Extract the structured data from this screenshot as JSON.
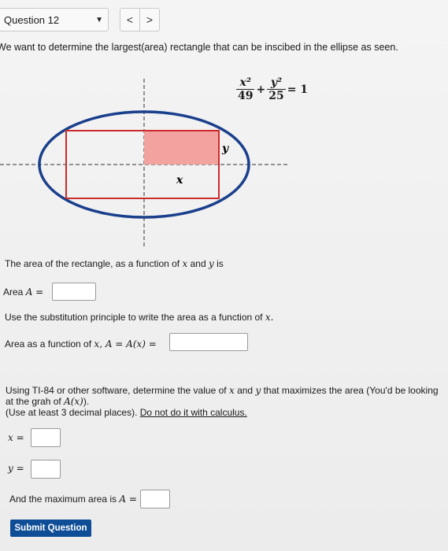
{
  "header": {
    "question_label": "Question 12",
    "prev_symbol": "<",
    "next_symbol": ">"
  },
  "intro": "We want to determine the largest(area) rectangle that can be inscibed in the ellipse as seen.",
  "figure": {
    "equation": {
      "term1_num": "x²",
      "term1_den": "49",
      "plus": "+",
      "term2_num": "y²",
      "term2_den": "25",
      "equals": "= 1"
    },
    "label_x": "x",
    "label_y": "y",
    "colors": {
      "ellipse": "#1a3f8c",
      "rectangle": "#cc2b2b",
      "shaded": "#f2a3a0",
      "axes": "#333333"
    }
  },
  "part1": {
    "prompt_pre": "The area of the rectangle, as a function of",
    "var_x": "x",
    "and": "and",
    "var_y": "y",
    "is": "is",
    "label_text": "Area",
    "label_math": "A ="
  },
  "part2": {
    "prompt_pre": "Use the substitution principle to write the area as a function of",
    "prompt_var": "x.",
    "label_text": "Area as a function of",
    "label_math": "x, A = A(x) ="
  },
  "part3": {
    "line1_pre": "Using TI-84 or other software, determine the value of",
    "line1_x": "x",
    "line1_and": "and",
    "line1_y": "y",
    "line1_post": "that maximizes the area (You'd be looking",
    "line2_pre": "at the grah of",
    "line2_math": "A(x)",
    "line2_post": ").",
    "line3_plain": "(Use at least 3 decimal places).",
    "line3_underlined": "Do not do it with calculus.",
    "x_label": "x =",
    "y_label": "y ="
  },
  "part4": {
    "label_text": "And the maximum area is",
    "label_math": "A ="
  },
  "submit_label": "Submit Question"
}
